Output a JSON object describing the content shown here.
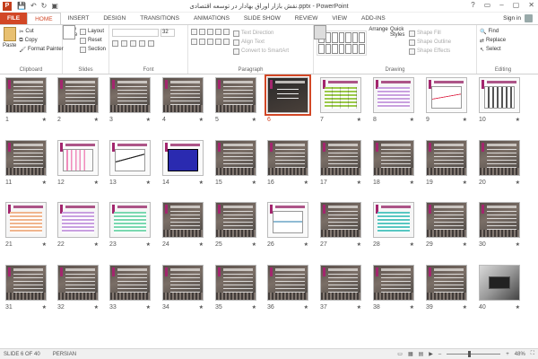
{
  "app": {
    "icon_letter": "P",
    "title": "نقش بازار اوراق بهادار در توسعه اقتصادی.pptx - PowerPoint",
    "window_controls": [
      "?",
      "▭",
      "–",
      "▢",
      "✕"
    ]
  },
  "tabs": [
    "FILE",
    "HOME",
    "INSERT",
    "DESIGN",
    "TRANSITIONS",
    "ANIMATIONS",
    "SLIDE SHOW",
    "REVIEW",
    "VIEW",
    "ADD-INS"
  ],
  "active_tab": "HOME",
  "signin": "Sign in",
  "ribbon": {
    "clipboard": {
      "paste": "Paste",
      "cut": "Cut",
      "copy": "Copy",
      "format_painter": "Format Painter",
      "label": "Clipboard"
    },
    "slides": {
      "new_slide": "New Slide",
      "layout": "Layout",
      "reset": "Reset",
      "section": "Section",
      "label": "Slides"
    },
    "font": {
      "size": "32",
      "label": "Font"
    },
    "paragraph": {
      "text_direction": "Text Direction",
      "align_text": "Align Text",
      "smartart": "Convert to SmartArt",
      "label": "Paragraph"
    },
    "drawing": {
      "arrange": "Arrange",
      "quick_styles": "Quick Styles",
      "shape_fill": "Shape Fill",
      "shape_outline": "Shape Outline",
      "shape_effects": "Shape Effects",
      "label": "Drawing"
    },
    "editing": {
      "find": "Find",
      "replace": "Replace",
      "select": "Select",
      "label": "Editing"
    }
  },
  "slides": [
    {
      "n": "1",
      "kind": "title"
    },
    {
      "n": "2",
      "kind": "text"
    },
    {
      "n": "3",
      "kind": "text"
    },
    {
      "n": "4",
      "kind": "text"
    },
    {
      "n": "5",
      "kind": "text"
    },
    {
      "n": "6",
      "kind": "darkc"
    },
    {
      "n": "7",
      "kind": "table"
    },
    {
      "n": "8",
      "kind": "table purple"
    },
    {
      "n": "9",
      "kind": "chart line"
    },
    {
      "n": "10",
      "kind": "chart bars2"
    },
    {
      "n": "11",
      "kind": "text"
    },
    {
      "n": "12",
      "kind": "chart bars"
    },
    {
      "n": "13",
      "kind": "chart curve"
    },
    {
      "n": "14",
      "kind": "chart blue"
    },
    {
      "n": "15",
      "kind": "text"
    },
    {
      "n": "16",
      "kind": "text"
    },
    {
      "n": "17",
      "kind": "text"
    },
    {
      "n": "18",
      "kind": "text"
    },
    {
      "n": "19",
      "kind": "text"
    },
    {
      "n": "20",
      "kind": "text"
    },
    {
      "n": "21",
      "kind": "table peach"
    },
    {
      "n": "22",
      "kind": "table purple"
    },
    {
      "n": "23",
      "kind": "table mint"
    },
    {
      "n": "24",
      "kind": "text"
    },
    {
      "n": "25",
      "kind": "text"
    },
    {
      "n": "26",
      "kind": "chart wave"
    },
    {
      "n": "27",
      "kind": "text"
    },
    {
      "n": "28",
      "kind": "table teal"
    },
    {
      "n": "29",
      "kind": "text"
    },
    {
      "n": "30",
      "kind": "text"
    },
    {
      "n": "31",
      "kind": "text"
    },
    {
      "n": "32",
      "kind": "text"
    },
    {
      "n": "33",
      "kind": "text"
    },
    {
      "n": "34",
      "kind": "text"
    },
    {
      "n": "35",
      "kind": "text"
    },
    {
      "n": "36",
      "kind": "text"
    },
    {
      "n": "37",
      "kind": "text"
    },
    {
      "n": "38",
      "kind": "text"
    },
    {
      "n": "39",
      "kind": "text"
    },
    {
      "n": "40",
      "kind": "photo"
    }
  ],
  "selected_slide": "6",
  "star": "★",
  "status": {
    "slide_info": "SLIDE 6 OF 40",
    "language": "PERSIAN",
    "zoom": "48%"
  }
}
